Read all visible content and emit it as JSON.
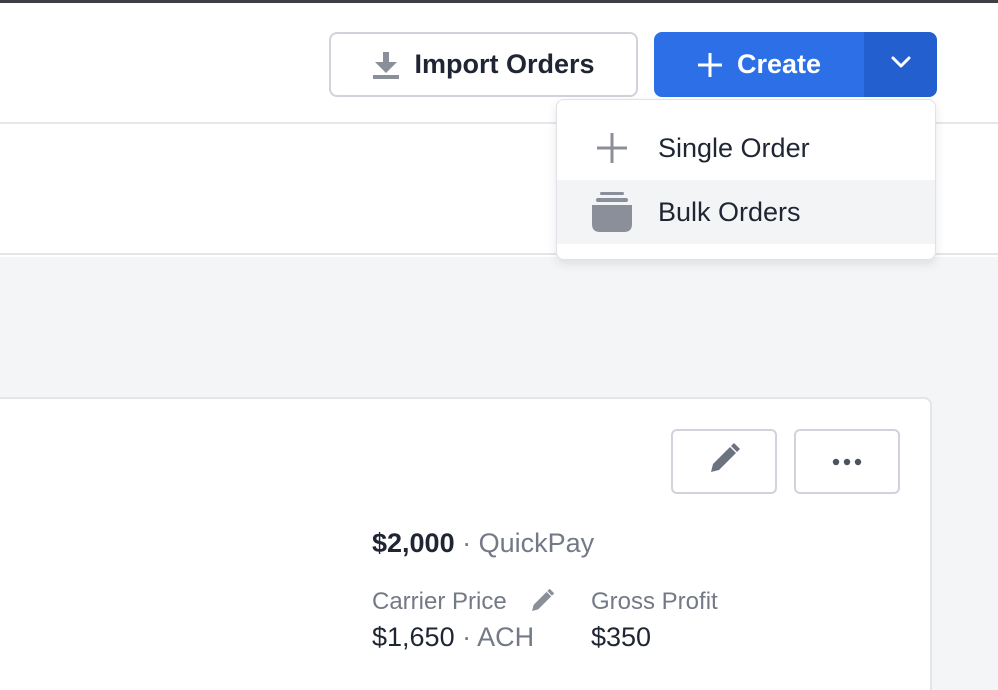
{
  "header": {
    "import_button": {
      "label": "Import Orders",
      "icon": "download-icon"
    },
    "create_button": {
      "label": "Create",
      "icon": "plus-icon"
    },
    "create_menu_toggle": {
      "icon": "chevron-down-icon"
    }
  },
  "create_menu": {
    "items": [
      {
        "label": "Single Order",
        "icon": "plus-icon"
      },
      {
        "label": "Bulk Orders",
        "icon": "stack-icon"
      }
    ]
  },
  "order_card": {
    "actions": {
      "edit_icon": "pencil-icon",
      "more_icon": "ellipsis-icon"
    },
    "customer_price": {
      "amount": "$2,000",
      "separator": " · ",
      "method": "QuickPay"
    },
    "carrier_price": {
      "label": "Carrier Price",
      "amount": "$1,650",
      "separator": " · ",
      "method": "ACH",
      "edit_icon": "pencil-icon"
    },
    "gross_profit": {
      "label": "Gross Profit",
      "amount": "$350"
    }
  },
  "colors": {
    "primary": "#2c6fe6",
    "primary_dark": "#235fce",
    "text": "#1f2533",
    "muted_text": "#737986",
    "icon_gray": "#8a8f99",
    "border": "#d0d4da",
    "content_bg": "#f4f5f7"
  }
}
